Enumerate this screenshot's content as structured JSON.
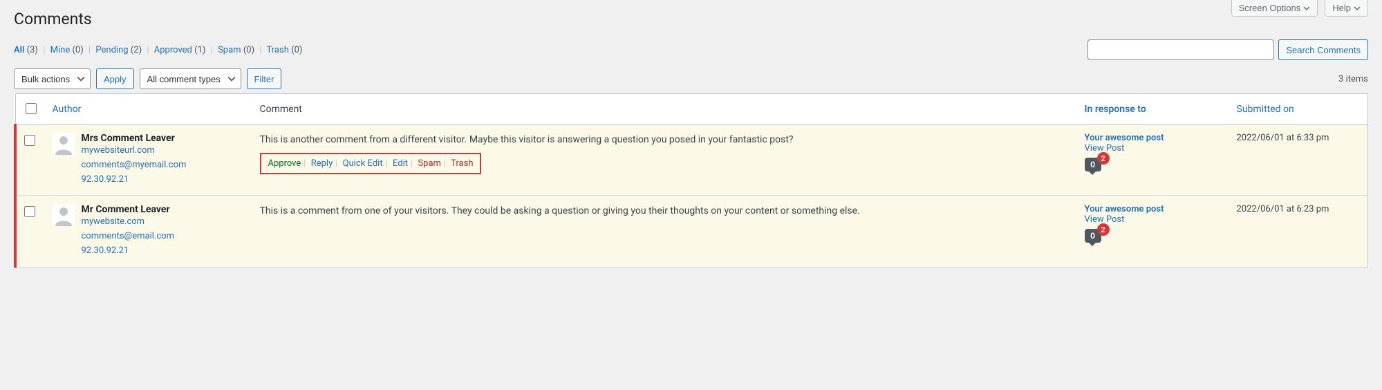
{
  "screen_tabs": {
    "screen_options": "Screen Options",
    "help": "Help"
  },
  "page_title": "Comments",
  "filters": {
    "all_label": "All",
    "all_count": "(3)",
    "mine_label": "Mine",
    "mine_count": "(0)",
    "pending_label": "Pending",
    "pending_count": "(2)",
    "approved_label": "Approved",
    "approved_count": "(1)",
    "spam_label": "Spam",
    "spam_count": "(0)",
    "trash_label": "Trash",
    "trash_count": "(0)"
  },
  "search": {
    "button": "Search Comments"
  },
  "bulk": {
    "bulk_actions": "Bulk actions",
    "apply": "Apply",
    "comment_types": "All comment types",
    "filter": "Filter"
  },
  "items_count": "3 items",
  "columns": {
    "author": "Author",
    "comment": "Comment",
    "response": "In response to",
    "date": "Submitted on"
  },
  "row_actions": {
    "approve": "Approve",
    "reply": "Reply",
    "quick_edit": "Quick Edit",
    "edit": "Edit",
    "spam": "Spam",
    "trash": "Trash"
  },
  "rows": [
    {
      "author_name": "Mrs Comment Leaver",
      "author_url": "mywebsiteurl.com",
      "author_email": "comments@myemail.com",
      "author_ip": "92.30.92.21",
      "comment_text": "This is another comment from a different visitor. Maybe this visitor is answering a question you posed in your fantastic post?",
      "post_title": "Your awesome post",
      "view_post": "View Post",
      "bubble_count": "0",
      "badge_count": "2",
      "date": "2022/06/01 at 6:33 pm",
      "show_actions": true
    },
    {
      "author_name": "Mr Comment Leaver",
      "author_url": "mywebsite.com",
      "author_email": "comments@email.com",
      "author_ip": "92.30.92.21",
      "comment_text": "This is a comment from one of your visitors. They could be asking a question or giving you their thoughts on your content or something else.",
      "post_title": "Your awesome post",
      "view_post": "View Post",
      "bubble_count": "0",
      "badge_count": "2",
      "date": "2022/06/01 at 6:23 pm",
      "show_actions": false
    }
  ]
}
